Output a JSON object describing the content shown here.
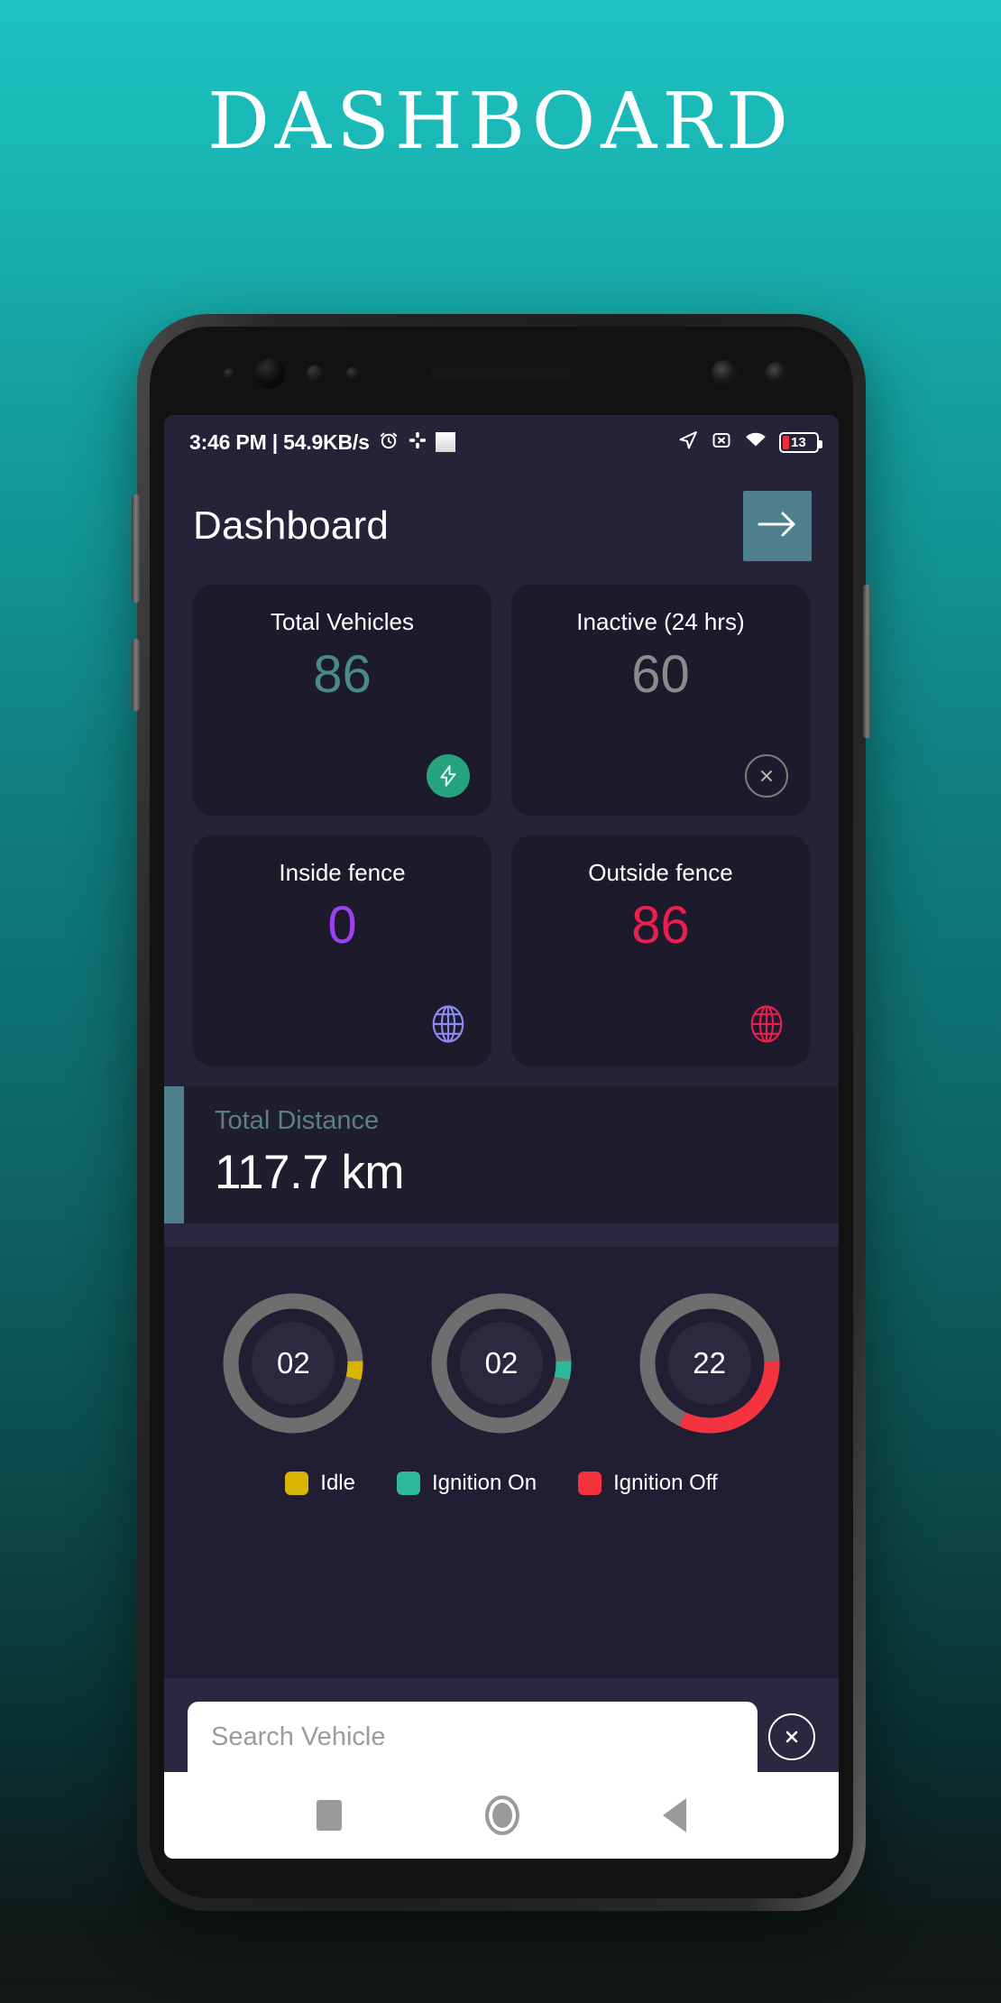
{
  "poster": {
    "title": "DASHBOARD"
  },
  "statusbar": {
    "left_text": "3:46 PM | 54.9KB/s",
    "icons_left": [
      "alarm-icon",
      "slack-icon",
      "white-square-icon"
    ],
    "icons_right": [
      "location-arrow-icon",
      "x-box-icon",
      "wifi-icon",
      "battery-icon"
    ],
    "battery_level": "13"
  },
  "appbar": {
    "title": "Dashboard",
    "action_icon": "arrow-right-icon",
    "action_bg": "#4d7f8c"
  },
  "cards": [
    {
      "title": "Total Vehicles",
      "value": "86",
      "value_color": "#4a8a8c",
      "icon": "bolt-icon",
      "icon_style": "filled-green",
      "icon_color": "#24a37c"
    },
    {
      "title": "Inactive (24 hrs)",
      "value": "60",
      "value_color": "#8b8b8b",
      "icon": "close-icon",
      "icon_style": "outline-gray",
      "icon_color": "#7d7d78"
    },
    {
      "title": "Inside fence",
      "value": "0",
      "value_color": "#9a41f0",
      "icon": "globe-icon",
      "icon_style": "globe",
      "icon_color": "#8c8cf0"
    },
    {
      "title": "Outside fence",
      "value": "86",
      "value_color": "#e8204f",
      "icon": "globe-icon",
      "icon_style": "globe",
      "icon_color": "#e8204f"
    }
  ],
  "distance": {
    "label": "Total Distance",
    "value": "117.7 km",
    "accent_color": "#4d7f8c"
  },
  "chart_data": {
    "type": "pie",
    "title": "Vehicle status donuts",
    "legend_position": "bottom",
    "categories": [
      "Idle",
      "Ignition On",
      "Ignition Off"
    ],
    "values": [
      2,
      2,
      22
    ],
    "labels": [
      "02",
      "02",
      "22"
    ],
    "colors": [
      "#d9b породи00",
      "#2cb89a",
      "#f5333f"
    ],
    "track_color": "#6e6e6e",
    "donuts": [
      {
        "label": "02",
        "value": 2,
        "color": "#d8b400",
        "legend": "Idle",
        "arc_start_deg": 88,
        "arc_sweep_deg": 16
      },
      {
        "label": "02",
        "value": 2,
        "color": "#2cb89a",
        "legend": "Ignition On",
        "arc_start_deg": 88,
        "arc_sweep_deg": 16
      },
      {
        "label": "22",
        "value": 22,
        "color": "#f5333f",
        "legend": "Ignition Off",
        "arc_start_deg": 88,
        "arc_sweep_deg": 118
      }
    ]
  },
  "legend": [
    {
      "label": "Idle",
      "color": "#d8b400"
    },
    {
      "label": "Ignition On",
      "color": "#2cb89a"
    },
    {
      "label": "Ignition Off",
      "color": "#f5333f"
    }
  ],
  "search": {
    "placeholder": "Search Vehicle",
    "value": "",
    "clear_icon": "close-circle-icon"
  },
  "navbar": {
    "items": [
      "recents-button",
      "home-button",
      "back-button"
    ]
  }
}
